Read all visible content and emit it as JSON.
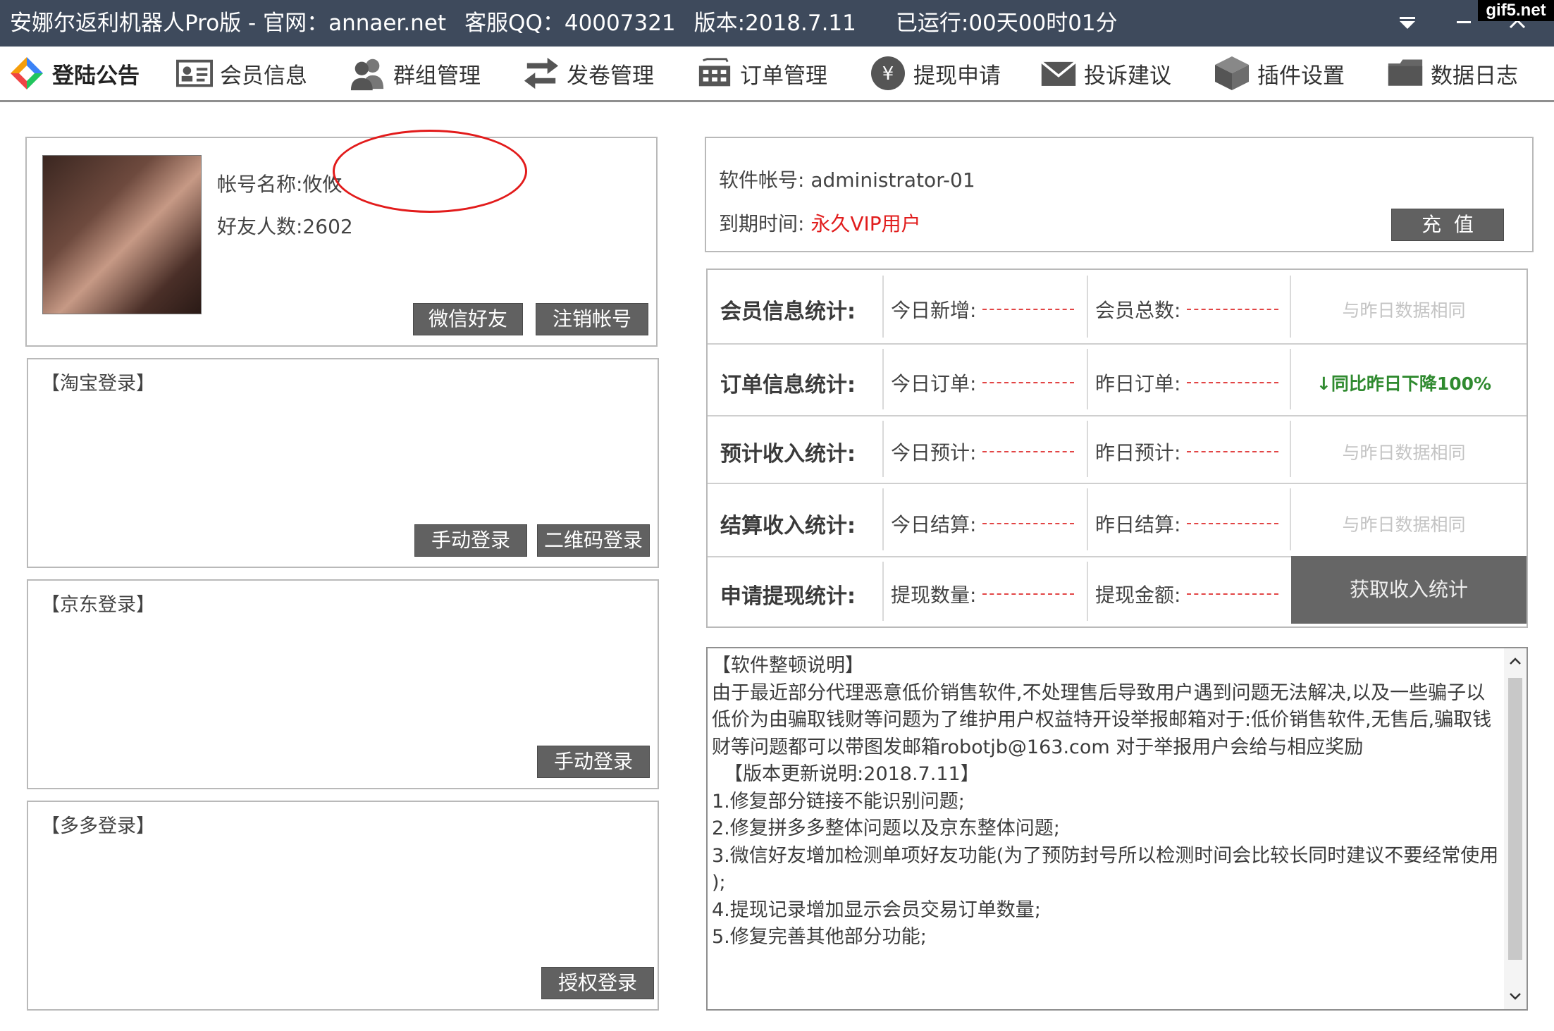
{
  "titlebar": {
    "app_name": "安娜尔返利机器人Pro版 - 官网：annaer.net",
    "qq": "客服QQ：40007321",
    "version": "版本:2018.7.11",
    "runtime": "已运行:00天00时01分",
    "watermark": "gif5.net"
  },
  "nav": [
    {
      "label": "登陆公告",
      "icon": "announcement-icon"
    },
    {
      "label": "会员信息",
      "icon": "member-card-icon"
    },
    {
      "label": "群组管理",
      "icon": "group-users-icon"
    },
    {
      "label": "发卷管理",
      "icon": "transfer-arrows-icon"
    },
    {
      "label": "订单管理",
      "icon": "shopping-cart-icon"
    },
    {
      "label": "提现申请",
      "icon": "yen-coin-icon"
    },
    {
      "label": "投诉建议",
      "icon": "envelope-icon"
    },
    {
      "label": "插件设置",
      "icon": "cube-icon"
    },
    {
      "label": "数据日志",
      "icon": "folder-icon"
    }
  ],
  "profile": {
    "account_name": "帐号名称:攸攸",
    "friend_count": "好友人数:2602",
    "wechat_friends_btn": "微信好友",
    "logout_btn": "注销帐号"
  },
  "taobao": {
    "title": "【淘宝登录】",
    "manual_btn": "手动登录",
    "qr_btn": "二维码登录"
  },
  "jd": {
    "title": "【京东登录】",
    "manual_btn": "手动登录"
  },
  "duoduo": {
    "title": "【多多登录】",
    "auth_btn": "授权登录"
  },
  "account": {
    "software_account": "软件帐号: administrator-01",
    "expiry_label": "到期时间: ",
    "expiry_value": "永久VIP用户",
    "recharge_btn": "充  值"
  },
  "stats": [
    {
      "label": "会员信息统计:",
      "key1": "今日新增:",
      "key2": "会员总数:",
      "note": "与昨日数据相同"
    },
    {
      "label": "订单信息统计:",
      "key1": "今日订单:",
      "key2": "昨日订单:",
      "note": "↓同比昨日下降100%"
    },
    {
      "label": "预计收入统计:",
      "key1": "今日预计:",
      "key2": "昨日预计:",
      "note": "与昨日数据相同"
    },
    {
      "label": "结算收入统计:",
      "key1": "今日结算:",
      "key2": "昨日结算:",
      "note": "与昨日数据相同"
    },
    {
      "label": "申请提现统计:",
      "key1": "提现数量:",
      "key2": "提现金额:",
      "note": "获取收入统计"
    }
  ],
  "notice": [
    "【软件整顿说明】",
    "由于最近部分代理恶意低价销售软件,不处理售后导致用户遇到问题无法解决,以及一些骗子以",
    "低价为由骗取钱财等问题为了维护用户权益特开设举报邮箱对于:低价销售软件,无售后,骗取钱",
    "财等问题都可以带图发邮箱robotjb@163.com 对于举报用户会给与相应奖励",
    "",
    "  【版本更新说明:2018.7.11】",
    "1.修复部分链接不能识别问题;",
    "2.修复拼多多整体问题以及京东整体问题;",
    "3.微信好友增加检测单项好友功能(为了预防封号所以检测时间会比较长同时建议不要经常使用",
    ");",
    "4.提现记录增加显示会员交易订单数量;",
    "5.修复完善其他部分功能;"
  ],
  "colors": {
    "titlebar": "#3e4a5c",
    "button": "#616161",
    "vip": "#e11d1d",
    "dashes": "#e24545",
    "highlight_circle": "#e21b1b",
    "trend_down": "#2f8a2f"
  }
}
